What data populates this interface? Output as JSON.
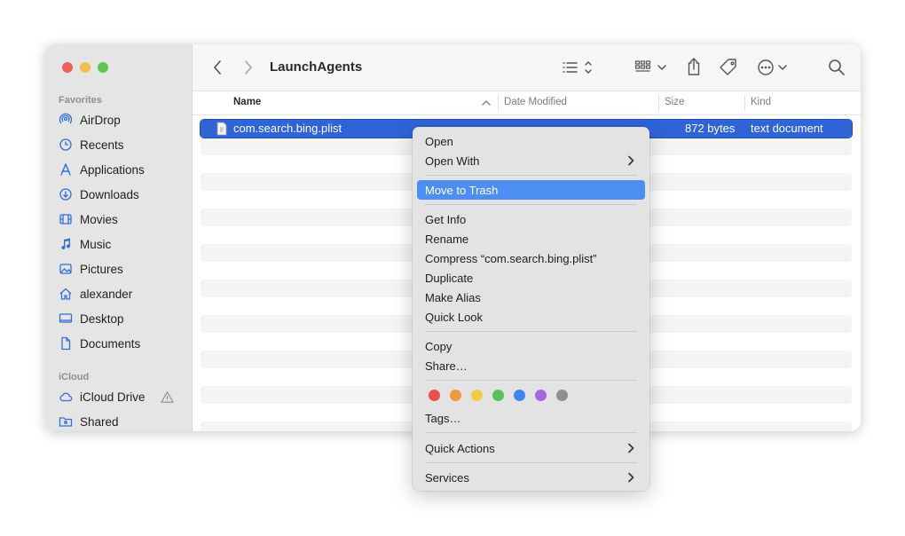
{
  "window": {
    "title": "LaunchAgents"
  },
  "sidebar": {
    "favorites_label": "Favorites",
    "icloud_label": "iCloud",
    "items": [
      {
        "label": "AirDrop",
        "icon": "airdrop-icon"
      },
      {
        "label": "Recents",
        "icon": "clock-icon"
      },
      {
        "label": "Applications",
        "icon": "applications-icon"
      },
      {
        "label": "Downloads",
        "icon": "download-icon"
      },
      {
        "label": "Movies",
        "icon": "film-icon"
      },
      {
        "label": "Music",
        "icon": "music-note-icon"
      },
      {
        "label": "Pictures",
        "icon": "photo-icon"
      },
      {
        "label": "alexander",
        "icon": "home-icon"
      },
      {
        "label": "Desktop",
        "icon": "desktop-icon"
      },
      {
        "label": "Documents",
        "icon": "document-icon"
      }
    ],
    "icloud_items": [
      {
        "label": "iCloud Drive",
        "icon": "cloud-icon"
      },
      {
        "label": "Shared",
        "icon": "shared-folder-icon"
      }
    ]
  },
  "columns": {
    "name": "Name",
    "date": "Date Modified",
    "size": "Size",
    "kind": "Kind"
  },
  "file": {
    "name": "com.search.bing.plist",
    "size": "872 bytes",
    "kind": "text document"
  },
  "context_menu": {
    "open": "Open",
    "open_with": "Open With",
    "move_to_trash": "Move to Trash",
    "get_info": "Get Info",
    "rename": "Rename",
    "compress": "Compress “com.search.bing.plist”",
    "duplicate": "Duplicate",
    "make_alias": "Make Alias",
    "quick_look": "Quick Look",
    "copy": "Copy",
    "share": "Share…",
    "tags": "Tags…",
    "quick_actions": "Quick Actions",
    "services": "Services",
    "tag_colors": [
      "#e6534e",
      "#f19a3c",
      "#f3c94a",
      "#5cc15a",
      "#3f86f0",
      "#a566d9",
      "#8e8e8e"
    ]
  },
  "colors": {
    "selection": "#2f64d6",
    "menu_highlight": "#4c8ef2",
    "sidebar_icon": "#2f6fd9"
  }
}
